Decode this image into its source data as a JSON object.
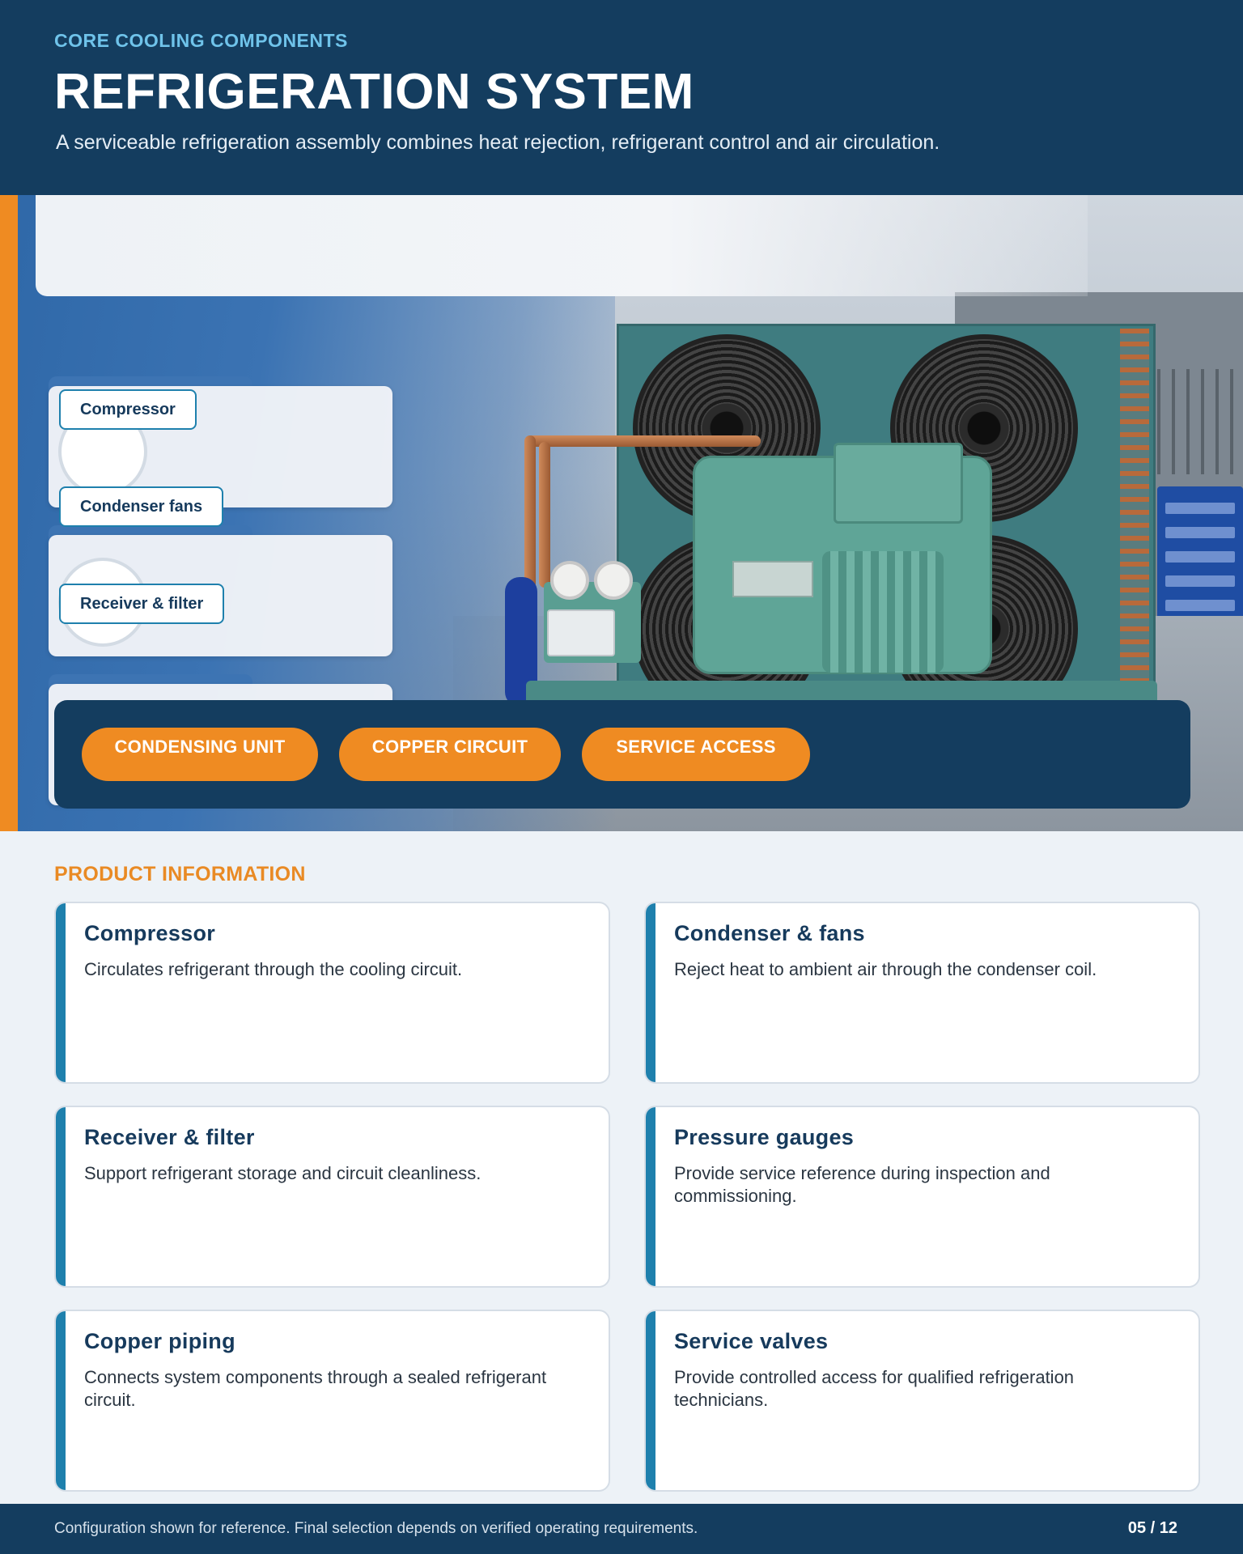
{
  "header": {
    "eyebrow": "CORE COOLING COMPONENTS",
    "title": "REFRIGERATION SYSTEM",
    "subtitle": "A serviceable refrigeration assembly combines heat rejection, refrigerant control and air circulation."
  },
  "hero": {
    "image_subject": "condensing-unit-photo",
    "callouts": [
      "Compressor",
      "Condenser fans",
      "Receiver & filter"
    ],
    "pills": [
      "CONDENSING UNIT",
      "COPPER CIRCUIT",
      "SERVICE ACCESS"
    ]
  },
  "product_info": {
    "heading": "PRODUCT INFORMATION",
    "cards": [
      {
        "title": "Compressor",
        "description": "Circulates refrigerant through the cooling circuit."
      },
      {
        "title": "Condenser & fans",
        "description": "Reject heat to ambient air through the condenser coil."
      },
      {
        "title": "Receiver & filter",
        "description": "Support refrigerant storage and circuit cleanliness."
      },
      {
        "title": "Pressure gauges",
        "description": "Provide service reference during inspection and commissioning."
      },
      {
        "title": "Copper piping",
        "description": "Connects system components through a sealed refrigerant circuit."
      },
      {
        "title": "Service valves",
        "description": "Provide controlled access for qualified refrigeration technicians."
      }
    ]
  },
  "footer": {
    "note": "Configuration shown for reference. Final selection depends on verified operating requirements.",
    "page": "05 / 12"
  },
  "colors": {
    "navy": "#143d5f",
    "orange": "#ef8b22",
    "blue_accent": "#1e80ad",
    "light_blue": "#6fc3ea"
  }
}
